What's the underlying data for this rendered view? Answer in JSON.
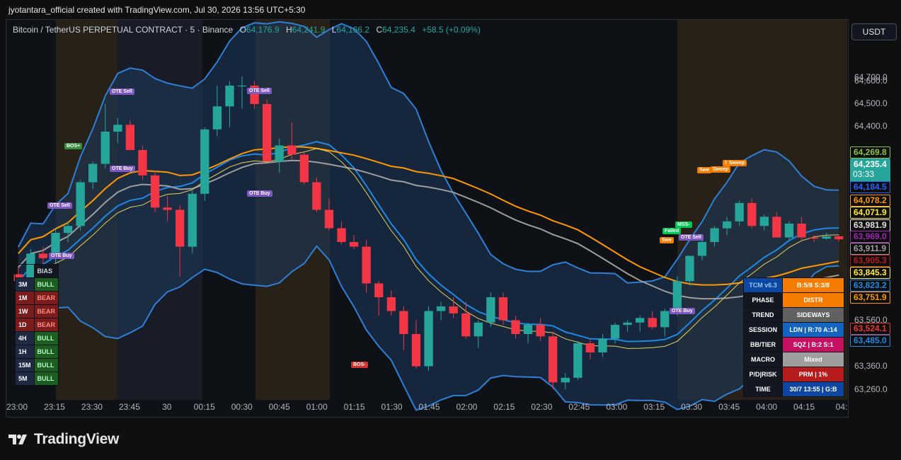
{
  "header": {
    "title": "jyotantara_official created with TradingView.com, Jul 30, 2026 13:56 UTC+5:30"
  },
  "legend": {
    "symbol": "Bitcoin / TetherUS PERPETUAL CONTRACT · 5 · Binance",
    "o_label": "O",
    "o_value": "64,176.9",
    "h_label": "H",
    "h_value": "64,241.9",
    "l_label": "L",
    "l_value": "64,166.2",
    "c_label": "C",
    "c_value": "64,235.4",
    "change": "+58.5 (+0.09%)"
  },
  "currency_button": "USDT",
  "brand": "TradingView",
  "colors": {
    "up": "#26a69a",
    "down": "#f23645",
    "bb": "#2962ff",
    "orange": "#ff9800"
  },
  "price_axis": [
    "64,700.0",
    "64,600.0",
    "64,500.0",
    "64,400.0",
    "63,560.0",
    "63,360.0",
    "63,260.0"
  ],
  "price_tags": [
    {
      "text": "64,269.8",
      "color": "#8bc34a"
    },
    {
      "text": "64,235.4",
      "color": "#26a69a",
      "sub": "03:33"
    },
    {
      "text": "64,184.5",
      "color": "#2962ff"
    },
    {
      "text": "64,078.2",
      "color": "#ff9800"
    },
    {
      "text": "64,071.9",
      "color": "#ffeb3b"
    },
    {
      "text": "63,981.9",
      "color": "#e0e0e0"
    },
    {
      "text": "63,969.0",
      "color": "#9c27b0"
    },
    {
      "text": "63,911.9",
      "color": "#9e9e9e"
    },
    {
      "text": "63,905.3",
      "color": "#b71c1c"
    },
    {
      "text": "63,845.3",
      "color": "#ffeb3b"
    },
    {
      "text": "63,823.2",
      "color": "#1e88e5"
    },
    {
      "text": "63,751.9",
      "color": "#ff9800"
    },
    {
      "text": "63,524.1",
      "color": "#e53935"
    },
    {
      "text": "63,485.0",
      "color": "#1e88e5"
    }
  ],
  "time_axis": [
    "23:00",
    "23:15",
    "23:30",
    "23:45",
    "30",
    "00:15",
    "00:30",
    "00:45",
    "01:00",
    "01:15",
    "01:30",
    "01:45",
    "02:00",
    "02:15",
    "02:30",
    "02:45",
    "03:00",
    "03:15",
    "03:30",
    "03:45",
    "04:00",
    "04:15",
    "04:"
  ],
  "bias_table": {
    "header": "BIAS",
    "rows": [
      {
        "tf": "3M",
        "bias": "BULL"
      },
      {
        "tf": "1M",
        "bias": "BEAR"
      },
      {
        "tf": "1W",
        "bias": "BEAR"
      },
      {
        "tf": "1D",
        "bias": "BEAR"
      },
      {
        "tf": "4H",
        "bias": "BULL"
      },
      {
        "tf": "1H",
        "bias": "BULL"
      },
      {
        "tf": "15M",
        "bias": "BULL"
      },
      {
        "tf": "5M",
        "bias": "BULL"
      }
    ]
  },
  "tcm_table": [
    {
      "label": "TCM v6.3",
      "value": "B:5/8 S:3/8"
    },
    {
      "label": "PHASE",
      "value": "DISTR"
    },
    {
      "label": "TREND",
      "value": "SIDEWAYS"
    },
    {
      "label": "SESSION",
      "value": "LDN | R:70 A:14"
    },
    {
      "label": "BB/TIER",
      "value": "SQZ | B:2 S:1"
    },
    {
      "label": "MACRO",
      "value": "Mixed"
    },
    {
      "label": "P/D|RISK",
      "value": "PRM | 1%"
    },
    {
      "label": "TIME",
      "value": "30/7 13:55 | G:B"
    }
  ],
  "annotations": [
    {
      "text": "OTE Sell"
    },
    {
      "text": "OTE Sell"
    },
    {
      "text": "OTE Sell"
    },
    {
      "text": "OTE Sell"
    },
    {
      "text": "OTE Buy"
    },
    {
      "text": "OTE Buy"
    },
    {
      "text": "OTE Buy"
    },
    {
      "text": "OTE Buy"
    },
    {
      "text": "BOS+"
    },
    {
      "text": "BOS-"
    },
    {
      "text": "Swe"
    },
    {
      "text": "Swe"
    },
    {
      "text": "Sweep"
    },
    {
      "text": "Sweep"
    },
    {
      "text": "Sweep"
    },
    {
      "text": "MSS-"
    },
    {
      "text": "Failed"
    }
  ],
  "chart_data": {
    "type": "candlestick",
    "symbol": "Bitcoin / TetherUS PERPETUAL CONTRACT",
    "interval": "5",
    "exchange": "Binance",
    "grid": false,
    "candles_ohlc": [
      [
        63760,
        63790,
        63700,
        63730
      ],
      [
        63730,
        63870,
        63700,
        63850
      ],
      [
        63850,
        63880,
        63800,
        63830
      ],
      [
        63830,
        63960,
        63800,
        63940
      ],
      [
        63940,
        63990,
        63900,
        63970
      ],
      [
        63970,
        64170,
        63950,
        64160
      ],
      [
        64160,
        64250,
        64130,
        64240
      ],
      [
        64240,
        64500,
        64220,
        64380
      ],
      [
        64380,
        64440,
        64330,
        64410
      ],
      [
        64410,
        64430,
        64300,
        64300
      ],
      [
        64300,
        64320,
        64170,
        64190
      ],
      [
        64190,
        64210,
        64030,
        64050
      ],
      [
        64050,
        64100,
        63990,
        64040
      ],
      [
        64040,
        64060,
        63750,
        63880
      ],
      [
        63880,
        64130,
        63850,
        64110
      ],
      [
        64110,
        64400,
        64080,
        64390
      ],
      [
        64390,
        64580,
        64360,
        64490
      ],
      [
        64490,
        64600,
        64400,
        64580
      ],
      [
        64580,
        64620,
        64480,
        64580
      ],
      [
        64580,
        64600,
        64480,
        64500
      ],
      [
        64500,
        64520,
        64280,
        64250
      ],
      [
        64250,
        64350,
        64200,
        64320
      ],
      [
        64320,
        64420,
        64260,
        64280
      ],
      [
        64280,
        64290,
        64150,
        64160
      ],
      [
        64160,
        64180,
        64030,
        64040
      ],
      [
        64040,
        64090,
        63950,
        63960
      ],
      [
        63960,
        63990,
        63890,
        63900
      ],
      [
        63900,
        63930,
        63870,
        63880
      ],
      [
        63880,
        63910,
        63680,
        63720
      ],
      [
        63720,
        63730,
        63580,
        63660
      ],
      [
        63660,
        63690,
        63580,
        63600
      ],
      [
        63600,
        63620,
        63430,
        63500
      ],
      [
        63500,
        63560,
        63350,
        63360
      ],
      [
        63360,
        63620,
        63340,
        63600
      ],
      [
        63600,
        63640,
        63560,
        63620
      ],
      [
        63620,
        63660,
        63570,
        63590
      ],
      [
        63590,
        63640,
        63480,
        63490
      ],
      [
        63490,
        63560,
        63440,
        63550
      ],
      [
        63550,
        63680,
        63530,
        63660
      ],
      [
        63660,
        63680,
        63540,
        63560
      ],
      [
        63560,
        63580,
        63480,
        63500
      ],
      [
        63500,
        63550,
        63460,
        63540
      ],
      [
        63540,
        63570,
        63470,
        63490
      ],
      [
        63490,
        63510,
        63260,
        63290
      ],
      [
        63290,
        63330,
        63260,
        63310
      ],
      [
        63310,
        63470,
        63300,
        63460
      ],
      [
        63460,
        63480,
        63390,
        63420
      ],
      [
        63420,
        63500,
        63400,
        63480
      ],
      [
        63480,
        63550,
        63460,
        63540
      ],
      [
        63540,
        63560,
        63510,
        63550
      ],
      [
        63550,
        63580,
        63510,
        63570
      ],
      [
        63570,
        63600,
        63520,
        63530
      ],
      [
        63530,
        63610,
        63490,
        63600
      ],
      [
        63600,
        63750,
        63580,
        63730
      ],
      [
        63730,
        63840,
        63710,
        63840
      ],
      [
        63840,
        63930,
        63820,
        63900
      ],
      [
        63900,
        63970,
        63880,
        63960
      ],
      [
        63960,
        64010,
        63930,
        63990
      ],
      [
        63990,
        64080,
        63970,
        64070
      ],
      [
        64070,
        64090,
        63960,
        63970
      ],
      [
        63970,
        64020,
        63950,
        64010
      ],
      [
        64010,
        64030,
        63920,
        63920
      ],
      [
        63920,
        63990,
        63910,
        63980
      ],
      [
        63980,
        64010,
        63910,
        63920
      ],
      [
        63920,
        63930,
        63900,
        63915
      ],
      [
        63915,
        63940,
        63910,
        63925
      ],
      [
        63925,
        63930,
        63900,
        63912
      ]
    ],
    "price_range": [
      63260,
      64700
    ]
  }
}
